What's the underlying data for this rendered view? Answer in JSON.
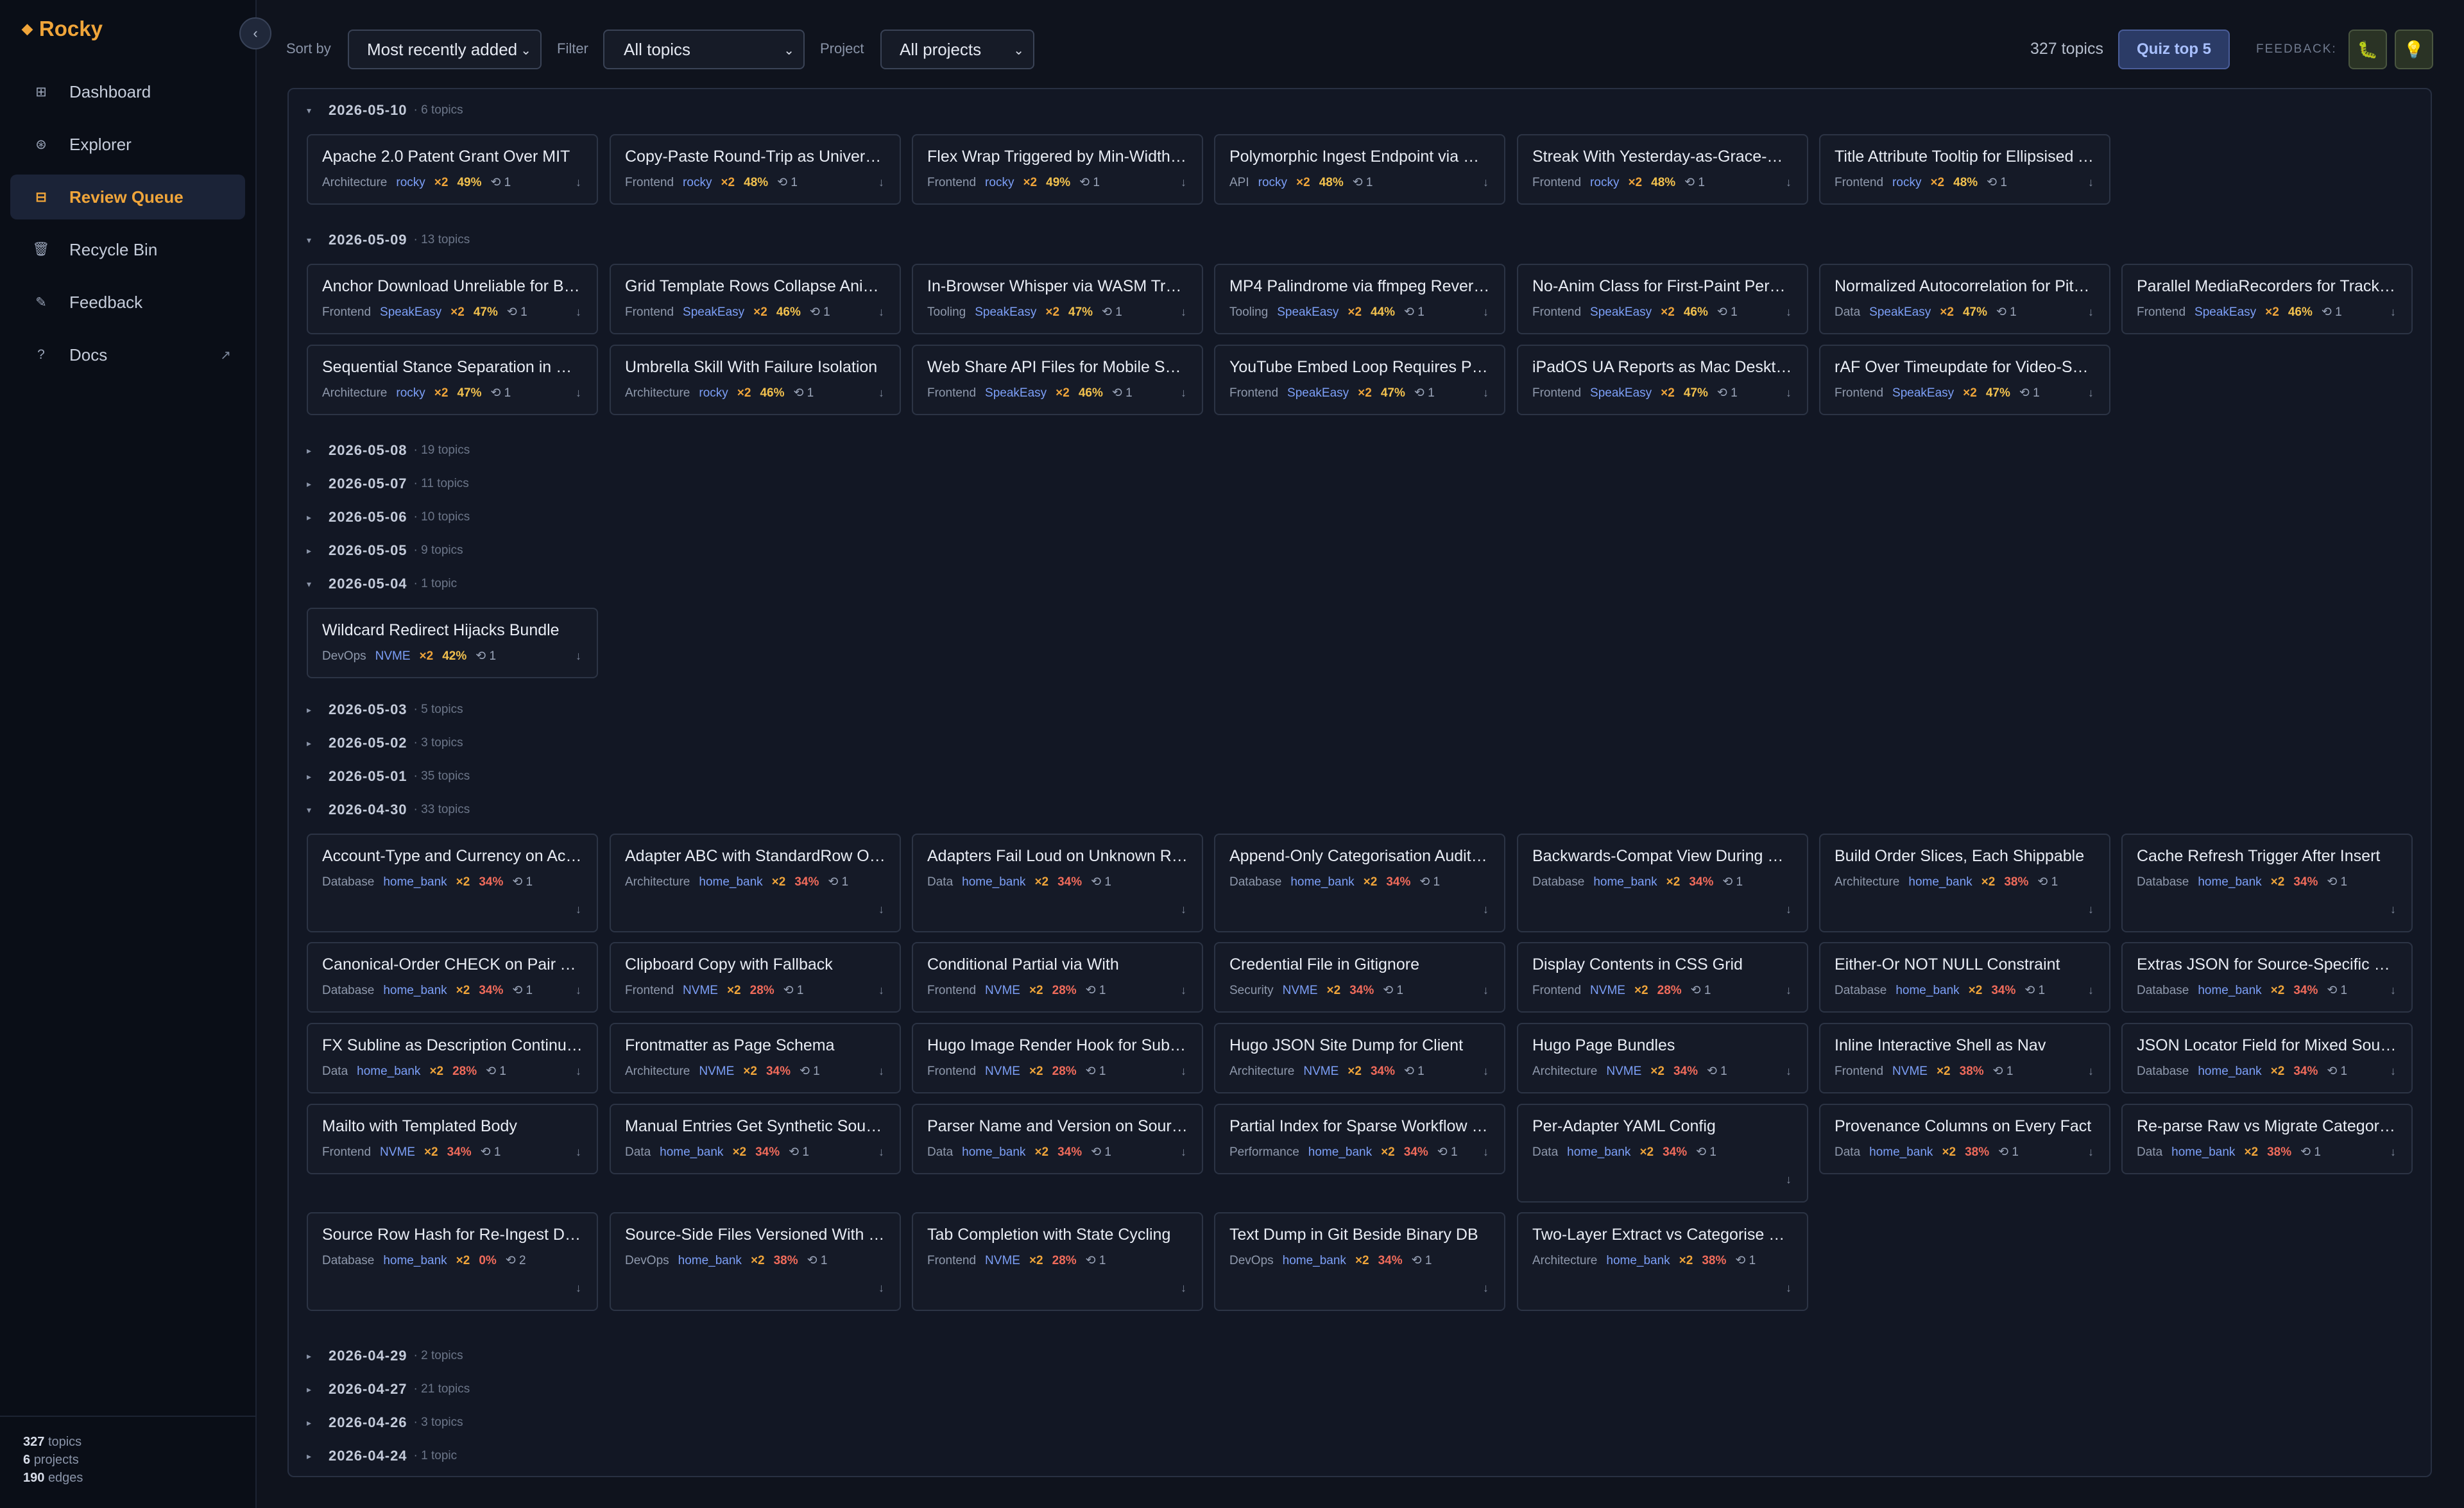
{
  "app": {
    "name": "Rocky",
    "logo_glyph": "◆",
    "accent": "#f0a53a"
  },
  "sidebar": {
    "collapse_glyph": "‹",
    "items": [
      {
        "label": "Dashboard",
        "icon": "grid-icon",
        "glyph": "⊞"
      },
      {
        "label": "Explorer",
        "icon": "compass-icon",
        "glyph": "⊛"
      },
      {
        "label": "Review Queue",
        "icon": "queue-icon",
        "glyph": "⊟",
        "active": true
      },
      {
        "label": "Recycle Bin",
        "icon": "trash-icon",
        "glyph": "🗑"
      },
      {
        "label": "Feedback",
        "icon": "pencil-icon",
        "glyph": "✎"
      },
      {
        "label": "Docs",
        "icon": "help-icon",
        "glyph": "?",
        "external": "↗"
      }
    ],
    "stats": [
      {
        "value": "327",
        "label": "topics"
      },
      {
        "value": "6",
        "label": "projects"
      },
      {
        "value": "190",
        "label": "edges"
      }
    ]
  },
  "toolbar": {
    "sort_label": "Sort by",
    "sort_value": "Most recently added",
    "filter_label": "Filter",
    "filter_value": "All topics",
    "project_label": "Project",
    "project_value": "All projects",
    "caret": "⌄",
    "count_text": "327 topics",
    "quiz_label": "Quiz top 5",
    "feedback_label": "FEEDBACK:",
    "bug_glyph": "🐛",
    "idea_glyph": "💡"
  },
  "groups": [
    {
      "date": "2026-05-10",
      "count": "6 topics",
      "expanded": true,
      "cards": [
        {
          "title": "Apache 2.0 Patent Grant Over MIT",
          "cat": "Architecture",
          "proj": "rocky",
          "mult": "×2",
          "pct": "49%",
          "pct_color": "yellow",
          "links": "⟲ 1"
        },
        {
          "title": "Copy-Paste Round-Trip as Univers…",
          "cat": "Frontend",
          "proj": "rocky",
          "mult": "×2",
          "pct": "48%",
          "pct_color": "yellow",
          "links": "⟲ 1"
        },
        {
          "title": "Flex Wrap Triggered by Min-Width …",
          "cat": "Frontend",
          "proj": "rocky",
          "mult": "×2",
          "pct": "49%",
          "pct_color": "yellow",
          "links": "⟲ 1"
        },
        {
          "title": "Polymorphic Ingest Endpoint via Op…",
          "cat": "API",
          "proj": "rocky",
          "mult": "×2",
          "pct": "48%",
          "pct_color": "yellow",
          "links": "⟲ 1"
        },
        {
          "title": "Streak With Yesterday-as-Grace-Da…",
          "cat": "Frontend",
          "proj": "rocky",
          "mult": "×2",
          "pct": "48%",
          "pct_color": "yellow",
          "links": "⟲ 1"
        },
        {
          "title": "Title Attribute Tooltip for Ellipsised T…",
          "cat": "Frontend",
          "proj": "rocky",
          "mult": "×2",
          "pct": "48%",
          "pct_color": "yellow",
          "links": "⟲ 1"
        }
      ]
    },
    {
      "date": "2026-05-09",
      "count": "13 topics",
      "expanded": true,
      "cards": [
        {
          "title": "Anchor Download Unreliable for Blo…",
          "cat": "Frontend",
          "proj": "SpeakEasy",
          "mult": "×2",
          "pct": "47%",
          "pct_color": "yellow",
          "links": "⟲ 1"
        },
        {
          "title": "Grid Template Rows Collapse Anim…",
          "cat": "Frontend",
          "proj": "SpeakEasy",
          "mult": "×2",
          "pct": "46%",
          "pct_color": "yellow",
          "links": "⟲ 1"
        },
        {
          "title": "In-Browser Whisper via WASM Tran…",
          "cat": "Tooling",
          "proj": "SpeakEasy",
          "mult": "×2",
          "pct": "47%",
          "pct_color": "yellow",
          "links": "⟲ 1"
        },
        {
          "title": "MP4 Palindrome via ffmpeg Revers…",
          "cat": "Tooling",
          "proj": "SpeakEasy",
          "mult": "×2",
          "pct": "44%",
          "pct_color": "yellow",
          "links": "⟲ 1"
        },
        {
          "title": "No-Anim Class for First-Paint Persi…",
          "cat": "Frontend",
          "proj": "SpeakEasy",
          "mult": "×2",
          "pct": "46%",
          "pct_color": "yellow",
          "links": "⟲ 1"
        },
        {
          "title": "Normalized Autocorrelation for Pitch…",
          "cat": "Data",
          "proj": "SpeakEasy",
          "mult": "×2",
          "pct": "47%",
          "pct_color": "yellow",
          "links": "⟲ 1"
        },
        {
          "title": "Parallel MediaRecorders for Track-…",
          "cat": "Frontend",
          "proj": "SpeakEasy",
          "mult": "×2",
          "pct": "46%",
          "pct_color": "yellow",
          "links": "⟲ 1"
        },
        {
          "title": "Sequential Stance Separation in Mu…",
          "cat": "Architecture",
          "proj": "rocky",
          "mult": "×2",
          "pct": "47%",
          "pct_color": "yellow",
          "links": "⟲ 1"
        },
        {
          "title": "Umbrella Skill With Failure Isolation",
          "cat": "Architecture",
          "proj": "rocky",
          "mult": "×2",
          "pct": "46%",
          "pct_color": "yellow",
          "links": "⟲ 1"
        },
        {
          "title": "Web Share API Files for Mobile Save",
          "cat": "Frontend",
          "proj": "SpeakEasy",
          "mult": "×2",
          "pct": "46%",
          "pct_color": "yellow",
          "links": "⟲ 1"
        },
        {
          "title": "YouTube Embed Loop Requires Pla…",
          "cat": "Frontend",
          "proj": "SpeakEasy",
          "mult": "×2",
          "pct": "47%",
          "pct_color": "yellow",
          "links": "⟲ 1"
        },
        {
          "title": "iPadOS UA Reports as Mac Desktop",
          "cat": "Frontend",
          "proj": "SpeakEasy",
          "mult": "×2",
          "pct": "47%",
          "pct_color": "yellow",
          "links": "⟲ 1"
        },
        {
          "title": "rAF Over Timeupdate for Video-Syn…",
          "cat": "Frontend",
          "proj": "SpeakEasy",
          "mult": "×2",
          "pct": "47%",
          "pct_color": "yellow",
          "links": "⟲ 1"
        }
      ]
    },
    {
      "date": "2026-05-08",
      "count": "19 topics",
      "expanded": false,
      "cards": []
    },
    {
      "date": "2026-05-07",
      "count": "11 topics",
      "expanded": false,
      "cards": []
    },
    {
      "date": "2026-05-06",
      "count": "10 topics",
      "expanded": false,
      "cards": []
    },
    {
      "date": "2026-05-05",
      "count": "9 topics",
      "expanded": false,
      "cards": []
    },
    {
      "date": "2026-05-04",
      "count": "1 topic",
      "expanded": true,
      "cards": [
        {
          "title": "Wildcard Redirect Hijacks Bundle",
          "cat": "DevOps",
          "proj": "NVME",
          "mult": "×2",
          "pct": "42%",
          "pct_color": "yellow",
          "links": "⟲ 1"
        }
      ]
    },
    {
      "date": "2026-05-03",
      "count": "5 topics",
      "expanded": false,
      "cards": []
    },
    {
      "date": "2026-05-02",
      "count": "3 topics",
      "expanded": false,
      "cards": []
    },
    {
      "date": "2026-05-01",
      "count": "35 topics",
      "expanded": false,
      "cards": []
    },
    {
      "date": "2026-04-30",
      "count": "33 topics",
      "expanded": true,
      "cards": [
        {
          "title": "Account-Type and Currency on Acc…",
          "cat": "Database",
          "proj": "home_bank",
          "mult": "×2",
          "pct": "34%",
          "pct_color": "red",
          "links": "⟲ 1"
        },
        {
          "title": "Adapter ABC with StandardRow Ou…",
          "cat": "Architecture",
          "proj": "home_bank",
          "mult": "×2",
          "pct": "34%",
          "pct_color": "red",
          "links": "⟲ 1"
        },
        {
          "title": "Adapters Fail Loud on Unknown Ro…",
          "cat": "Data",
          "proj": "home_bank",
          "mult": "×2",
          "pct": "34%",
          "pct_color": "red",
          "links": "⟲ 1"
        },
        {
          "title": "Append-Only Categorisation Audit L…",
          "cat": "Database",
          "proj": "home_bank",
          "mult": "×2",
          "pct": "34%",
          "pct_color": "red",
          "links": "⟲ 1"
        },
        {
          "title": "Backwards-Compat View During Mi…",
          "cat": "Database",
          "proj": "home_bank",
          "mult": "×2",
          "pct": "34%",
          "pct_color": "red",
          "links": "⟲ 1"
        },
        {
          "title": "Build Order Slices, Each Shippable",
          "cat": "Architecture",
          "proj": "home_bank",
          "mult": "×2",
          "pct": "38%",
          "pct_color": "red",
          "links": "⟲ 1"
        },
        {
          "title": "Cache Refresh Trigger After Insert",
          "cat": "Database",
          "proj": "home_bank",
          "mult": "×2",
          "pct": "34%",
          "pct_color": "red",
          "links": "⟲ 1"
        },
        {
          "title": "Canonical-Order CHECK on Pair Ta…",
          "cat": "Database",
          "proj": "home_bank",
          "mult": "×2",
          "pct": "34%",
          "pct_color": "red",
          "links": "⟲ 1"
        },
        {
          "title": "Clipboard Copy with Fallback",
          "cat": "Frontend",
          "proj": "NVME",
          "mult": "×2",
          "pct": "28%",
          "pct_color": "red",
          "links": "⟲ 1"
        },
        {
          "title": "Conditional Partial via With",
          "cat": "Frontend",
          "proj": "NVME",
          "mult": "×2",
          "pct": "28%",
          "pct_color": "red",
          "links": "⟲ 1"
        },
        {
          "title": "Credential File in Gitignore",
          "cat": "Security",
          "proj": "NVME",
          "mult": "×2",
          "pct": "34%",
          "pct_color": "red",
          "links": "⟲ 1"
        },
        {
          "title": "Display Contents in CSS Grid",
          "cat": "Frontend",
          "proj": "NVME",
          "mult": "×2",
          "pct": "28%",
          "pct_color": "red",
          "links": "⟲ 1"
        },
        {
          "title": "Either-Or NOT NULL Constraint",
          "cat": "Database",
          "proj": "home_bank",
          "mult": "×2",
          "pct": "34%",
          "pct_color": "red",
          "links": "⟲ 1"
        },
        {
          "title": "Extras JSON for Source-Specific W…",
          "cat": "Database",
          "proj": "home_bank",
          "mult": "×2",
          "pct": "34%",
          "pct_color": "red",
          "links": "⟲ 1"
        },
        {
          "title": "FX Subline as Description Continua…",
          "cat": "Data",
          "proj": "home_bank",
          "mult": "×2",
          "pct": "28%",
          "pct_color": "red",
          "links": "⟲ 1"
        },
        {
          "title": "Frontmatter as Page Schema",
          "cat": "Architecture",
          "proj": "NVME",
          "mult": "×2",
          "pct": "34%",
          "pct_color": "red",
          "links": "⟲ 1"
        },
        {
          "title": "Hugo Image Render Hook for Subp…",
          "cat": "Frontend",
          "proj": "NVME",
          "mult": "×2",
          "pct": "28%",
          "pct_color": "red",
          "links": "⟲ 1"
        },
        {
          "title": "Hugo JSON Site Dump for Client",
          "cat": "Architecture",
          "proj": "NVME",
          "mult": "×2",
          "pct": "34%",
          "pct_color": "red",
          "links": "⟲ 1"
        },
        {
          "title": "Hugo Page Bundles",
          "cat": "Architecture",
          "proj": "NVME",
          "mult": "×2",
          "pct": "34%",
          "pct_color": "red",
          "links": "⟲ 1"
        },
        {
          "title": "Inline Interactive Shell as Nav",
          "cat": "Frontend",
          "proj": "NVME",
          "mult": "×2",
          "pct": "38%",
          "pct_color": "red",
          "links": "⟲ 1"
        },
        {
          "title": "JSON Locator Field for Mixed Sour…",
          "cat": "Database",
          "proj": "home_bank",
          "mult": "×2",
          "pct": "34%",
          "pct_color": "red",
          "links": "⟲ 1"
        },
        {
          "title": "Mailto with Templated Body",
          "cat": "Frontend",
          "proj": "NVME",
          "mult": "×2",
          "pct": "34%",
          "pct_color": "red",
          "links": "⟲ 1"
        },
        {
          "title": "Manual Entries Get Synthetic Sourc…",
          "cat": "Data",
          "proj": "home_bank",
          "mult": "×2",
          "pct": "34%",
          "pct_color": "red",
          "links": "⟲ 1"
        },
        {
          "title": "Parser Name and Version on Sourc…",
          "cat": "Data",
          "proj": "home_bank",
          "mult": "×2",
          "pct": "34%",
          "pct_color": "red",
          "links": "⟲ 1"
        },
        {
          "title": "Partial Index for Sparse Workflow Fi…",
          "cat": "Performance",
          "proj": "home_bank",
          "mult": "×2",
          "pct": "34%",
          "pct_color": "red",
          "links": "⟲ 1"
        },
        {
          "title": "Per-Adapter YAML Config",
          "cat": "Data",
          "proj": "home_bank",
          "mult": "×2",
          "pct": "34%",
          "pct_color": "red",
          "links": "⟲ 1"
        },
        {
          "title": "Provenance Columns on Every Fact",
          "cat": "Data",
          "proj": "home_bank",
          "mult": "×2",
          "pct": "38%",
          "pct_color": "red",
          "links": "⟲ 1"
        },
        {
          "title": "Re-parse Raw vs Migrate Categorised",
          "cat": "Data",
          "proj": "home_bank",
          "mult": "×2",
          "pct": "38%",
          "pct_color": "red",
          "links": "⟲ 1"
        },
        {
          "title": "Source Row Hash for Re-Ingest De…",
          "cat": "Database",
          "proj": "home_bank",
          "mult": "×2",
          "pct": "0%",
          "pct_color": "red",
          "links": "⟲ 2"
        },
        {
          "title": "Source-Side Files Versioned With C…",
          "cat": "DevOps",
          "proj": "home_bank",
          "mult": "×2",
          "pct": "38%",
          "pct_color": "red",
          "links": "⟲ 1"
        },
        {
          "title": "Tab Completion with State Cycling",
          "cat": "Frontend",
          "proj": "NVME",
          "mult": "×2",
          "pct": "28%",
          "pct_color": "red",
          "links": "⟲ 1"
        },
        {
          "title": "Text Dump in Git Beside Binary DB",
          "cat": "DevOps",
          "proj": "home_bank",
          "mult": "×2",
          "pct": "34%",
          "pct_color": "red",
          "links": "⟲ 1"
        },
        {
          "title": "Two-Layer Extract vs Categorise Split",
          "cat": "Architecture",
          "proj": "home_bank",
          "mult": "×2",
          "pct": "38%",
          "pct_color": "red",
          "links": "⟲ 1"
        }
      ]
    },
    {
      "date": "2026-04-29",
      "count": "2 topics",
      "expanded": false,
      "cards": []
    },
    {
      "date": "2026-04-27",
      "count": "21 topics",
      "expanded": false,
      "cards": []
    },
    {
      "date": "2026-04-26",
      "count": "3 topics",
      "expanded": false,
      "cards": []
    },
    {
      "date": "2026-04-24",
      "count": "1 topic",
      "expanded": false,
      "cards": []
    }
  ],
  "card_action_glyph": "↓",
  "colors": {
    "pct_yellow": "#f2c14e",
    "pct_red": "#f06b5b",
    "project": "#7c9ff7"
  }
}
